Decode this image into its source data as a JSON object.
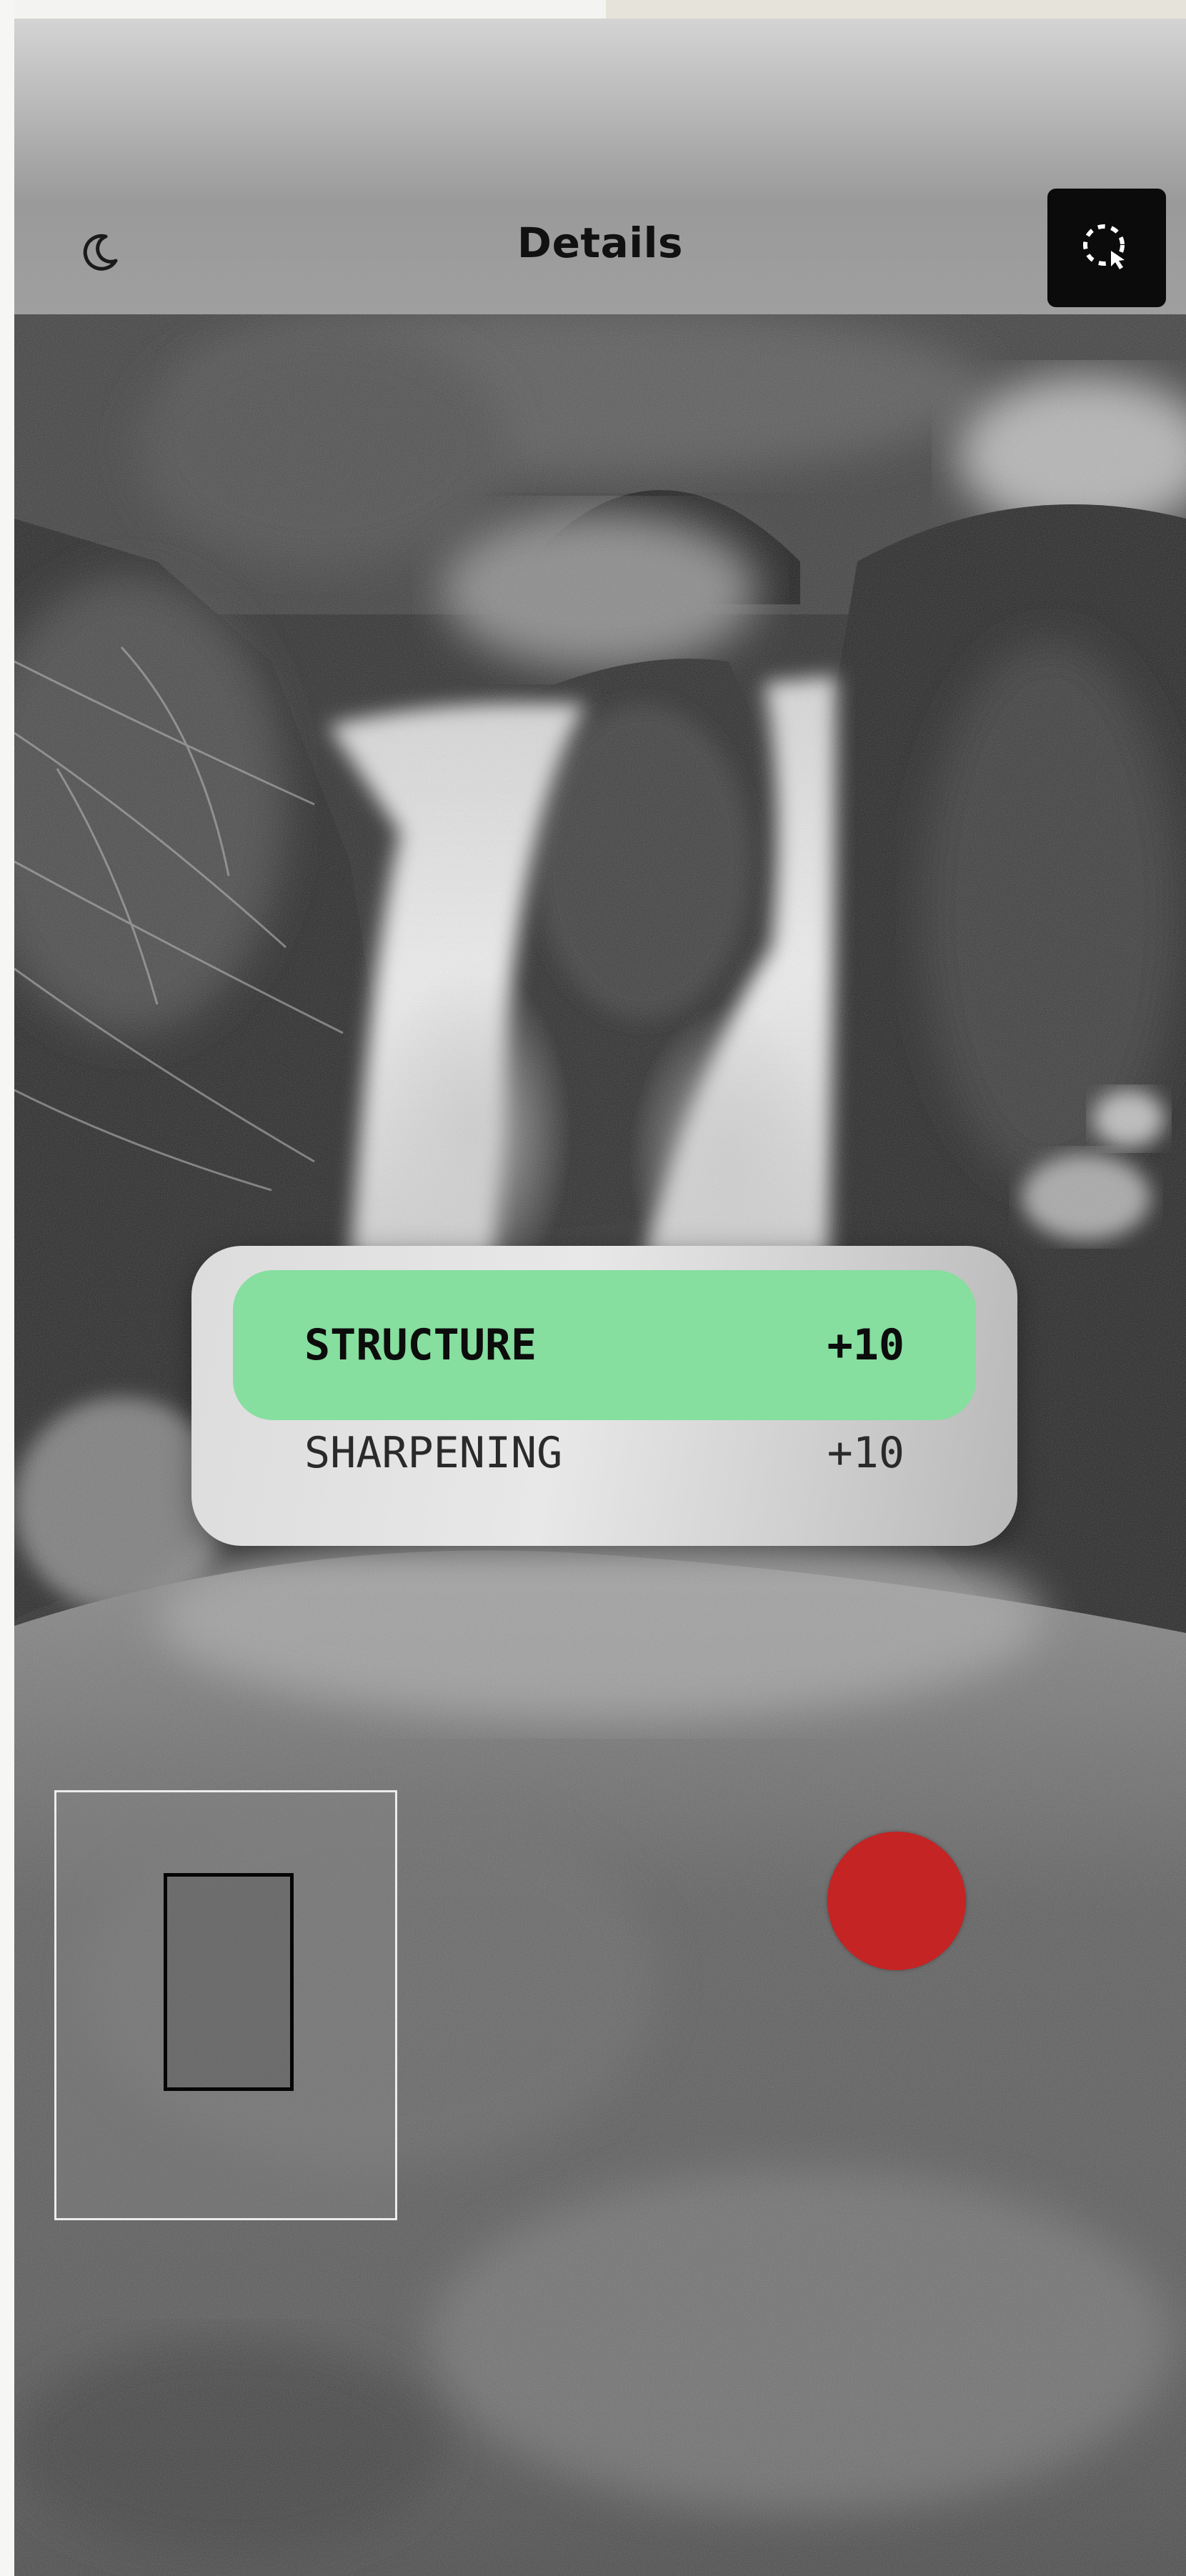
{
  "header": {
    "title": "Details",
    "theme_icon": "moon-icon",
    "select_icon": "selection-cursor-icon"
  },
  "adjustment_menu": {
    "items": [
      {
        "label": "STRUCTURE",
        "value": "+10",
        "active": true
      },
      {
        "label": "SHARPENING",
        "value": "+10",
        "active": false
      }
    ]
  },
  "colors": {
    "active_highlight": "#86de9f",
    "record_button": "#c42424",
    "header_button_bg": "#0b0b0b"
  }
}
